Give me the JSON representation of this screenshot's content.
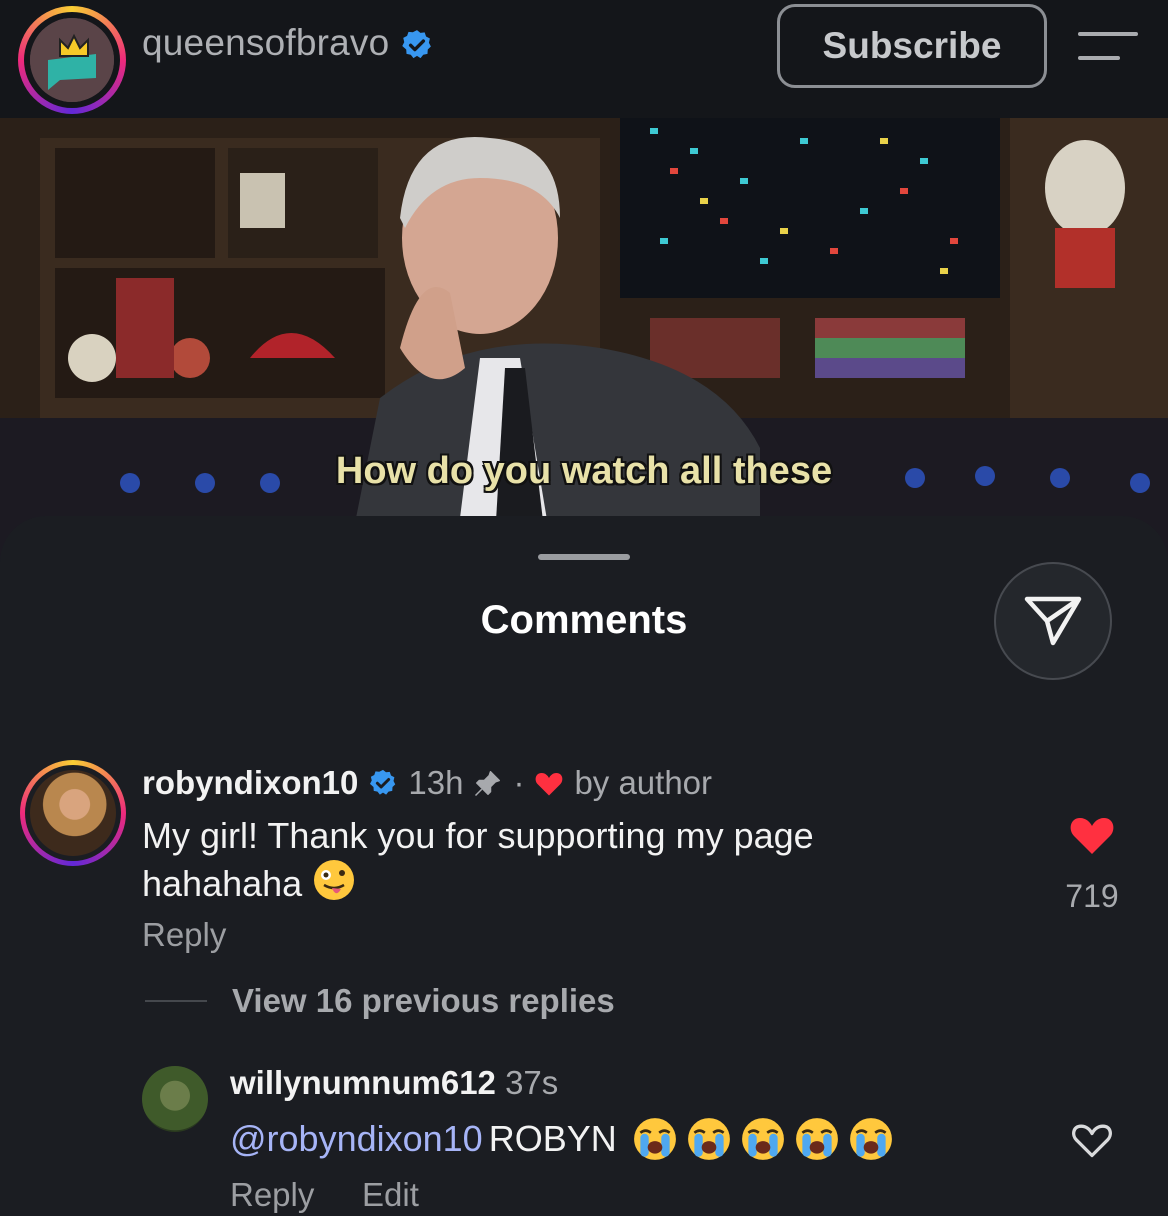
{
  "header": {
    "channel_name": "queensofbravo",
    "subscribe_label": "Subscribe"
  },
  "video": {
    "caption": "How do you watch all these"
  },
  "comments_sheet": {
    "title": "Comments",
    "comments": [
      {
        "username": "robyndixon10",
        "time": "13h",
        "separator": "·",
        "liked_by_author": "by author",
        "text": "My girl! Thank you for supporting my page hahahaha",
        "reply_label": "Reply",
        "like_count": "719",
        "view_replies": "View 16 previous replies"
      },
      {
        "username": "willynumnum612",
        "time": "37s",
        "mention": "@robyndixon10",
        "text": "ROBYN",
        "reply_label": "Reply",
        "edit_label": "Edit"
      }
    ]
  },
  "icons": {
    "verified": "verified-badge-icon",
    "pin": "pin-icon",
    "heart_filled": "heart-filled-icon",
    "heart_outline": "heart-outline-icon",
    "share": "send-icon",
    "menu": "menu-icon",
    "emoji_wink": "zany-face-emoji",
    "emoji_cry": "loudly-crying-face-emoji"
  },
  "colors": {
    "verified_blue": "#3897f0",
    "heart_red": "#ff3040",
    "mention_blue": "#a6b4f6"
  }
}
